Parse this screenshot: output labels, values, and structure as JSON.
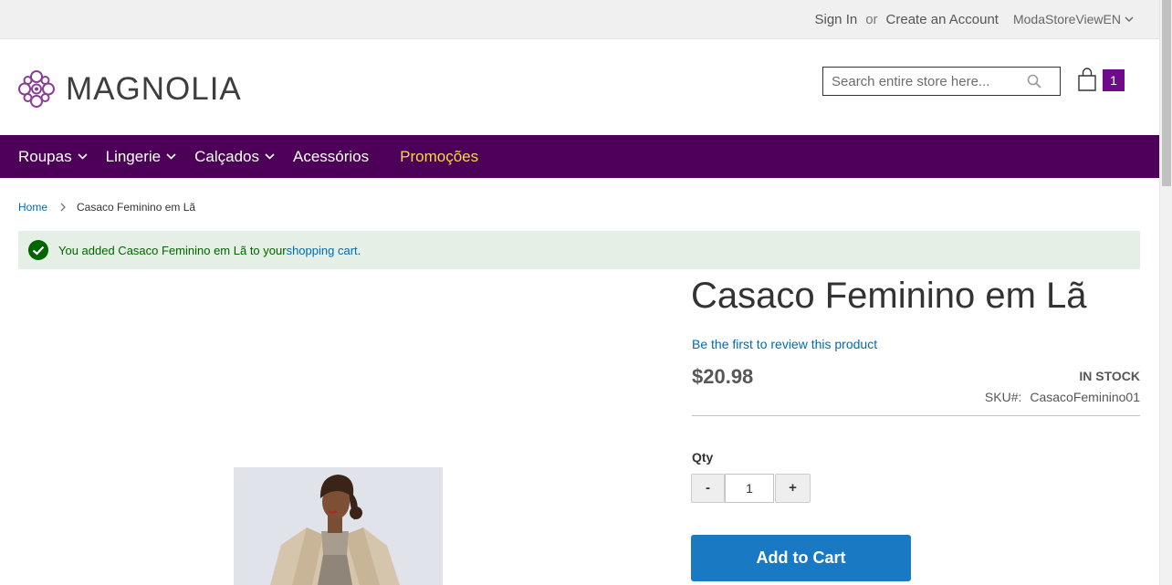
{
  "topbar": {
    "sign_in": "Sign In",
    "or": "or",
    "create_account": "Create an Account",
    "store_view": "ModaStoreViewEN"
  },
  "header": {
    "logo_text": "MAGNOLIA",
    "search_placeholder": "Search entire store here...",
    "cart_count": "1",
    "colors": {
      "brand_purple": "#4d0058",
      "badge": "#6f0a8c",
      "logo_purple": "#8a3f95"
    }
  },
  "nav": {
    "items": [
      {
        "label": "Roupas",
        "has_dropdown": true
      },
      {
        "label": "Lingerie",
        "has_dropdown": true
      },
      {
        "label": "Calçados",
        "has_dropdown": true
      },
      {
        "label": "Acessórios",
        "has_dropdown": false
      },
      {
        "label": "Promoções",
        "has_dropdown": false
      }
    ],
    "promo_color": "#f7d84a"
  },
  "breadcrumb": {
    "home": "Home",
    "current": "Casaco Feminino em Lã"
  },
  "message": {
    "text": "You added Casaco Feminino em Lã to your ",
    "link": "shopping cart",
    "suffix": "."
  },
  "product": {
    "title": "Casaco Feminino em Lã",
    "review_link": "Be the first to review this product",
    "price": "$20.98",
    "stock": "IN STOCK",
    "sku_label": "SKU#:",
    "sku_value": "CasacoFeminino01",
    "qty_label": "Qty",
    "qty_value": "1",
    "qty_minus": "-",
    "qty_plus": "+",
    "add_to_cart": "Add to Cart",
    "button_color": "#1979c3"
  }
}
